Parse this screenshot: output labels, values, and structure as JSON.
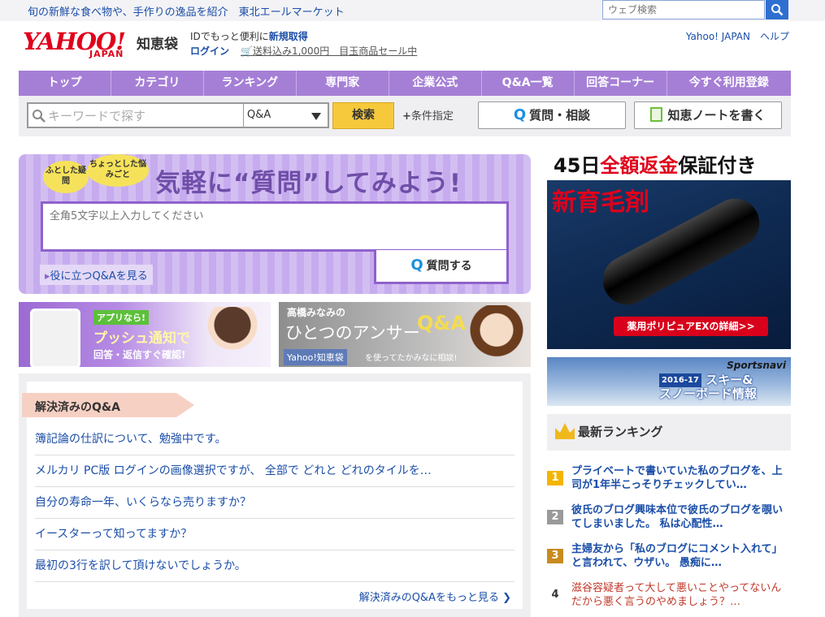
{
  "topbar": {
    "promo": "旬の新鮮な食べ物や、手作りの逸品を紹介　東北エールマーケット",
    "web_search_placeholder": "ウェブ検索"
  },
  "header": {
    "logo": "YAHOO!",
    "logo_sub": "JAPAN",
    "service": "知恵袋",
    "id_prefix": "IDでもっと便利に",
    "id_link": "新規取得",
    "login": "ログイン",
    "cart_promo": "送料込み1,000円　目玉商品セール中",
    "right_links": "Yahoo! JAPAN　ヘルプ"
  },
  "nav": [
    "トップ",
    "カテゴリ",
    "ランキング",
    "専門家",
    "企業公式",
    "Q&A一覧",
    "回答コーナー",
    "今すぐ利用登録"
  ],
  "search": {
    "placeholder": "キーワードで探す",
    "select": "Q&A",
    "button": "検索",
    "conditions": "条件指定",
    "ask_button": "質問・相談",
    "note_button": "知恵ノートを書く"
  },
  "ask": {
    "bubble1": "ふとした疑問",
    "bubble2": "ちょっとした悩みごと",
    "title": "気軽に“質問”してみよう!",
    "placeholder": "全角5文字以上入力してください",
    "button": "質問する",
    "useful": "役に立つQ&Aを見る"
  },
  "banner1": {
    "badge": "アプリなら!",
    "headline": "プッシュ通知で",
    "sub": "回答・返信すぐ確認!"
  },
  "banner2": {
    "name": "高橋みなみの",
    "title": "ひとつのアンサー",
    "qa": "Q&A",
    "service": "Yahoo!知恵袋",
    "tail": "を使ってたかみなに相談!"
  },
  "solved": {
    "title": "解決済みのQ&A",
    "items": [
      "簿記論の仕訳について、勉強中です。",
      "メルカリ PC版 ログインの画像選択ですが、 全部で どれと どれのタイルを…",
      "自分の寿命一年、いくらなら売りますか？",
      "イースターって知ってますか？",
      "最初の3行を訳して頂けないでしょうか。"
    ],
    "more": "解決済みのQ&Aをもっと見る ❯"
  },
  "ad": {
    "line1_pre": "45日",
    "line1_red": "全額返金",
    "line1_post": "保証付き",
    "line2_red": "新",
    "line2": "育毛剤",
    "button": "薬用ポリピュアEXの詳細>>"
  },
  "sportsnavi": {
    "brand": "Sportsnavi",
    "season": "2016-17",
    "line1": "スキー&",
    "line2": "スノーボード情報"
  },
  "ranking": {
    "title": "最新ランキング",
    "items": [
      {
        "num": "1",
        "text": "プライベートで書いていた私のブログを、上司が1年半こっそりチェックしてい…"
      },
      {
        "num": "2",
        "text": "彼氏のブログ興味本位で彼氏のブログを覗いてしまいました。 私は心配性…"
      },
      {
        "num": "3",
        "text": "主婦友から「私のブログにコメント入れて」と言われて、ウザい。 愚痴に…"
      },
      {
        "num": "4",
        "text": "滋谷容疑者って大して悪いことやってないんだから悪く言うのやめましょう？…"
      }
    ]
  }
}
